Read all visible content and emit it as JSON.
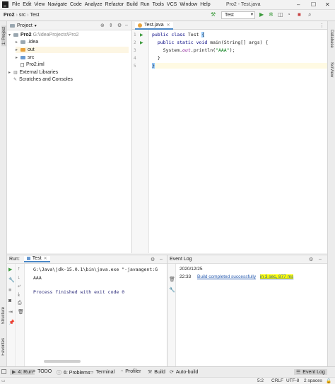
{
  "menubar": {
    "items": [
      "File",
      "Edit",
      "View",
      "Navigate",
      "Code",
      "Analyze",
      "Refactor",
      "Build",
      "Run",
      "Tools",
      "VCS",
      "Window",
      "Help"
    ],
    "window_title": "Pro2 - Test.java",
    "minimize": "–",
    "maximize": "☐",
    "close": "✕"
  },
  "navbar": {
    "breadcrumbs": [
      "Pro2",
      "src",
      "Test"
    ],
    "run_config": "Test"
  },
  "left_strip": {
    "top_tab": "1: Project",
    "bottom_tabs": [
      "Structure",
      "Favorites"
    ]
  },
  "right_strip": {
    "tabs": [
      "Database",
      "SciView"
    ]
  },
  "project": {
    "header": "Project",
    "tree": [
      {
        "label": "Pro2",
        "sub": "G:\\IdeaProjects\\Pro2",
        "arrow": "▾",
        "icon": "gray"
      },
      {
        "label": ".idea",
        "arrow": "▸",
        "icon": "gray"
      },
      {
        "label": "out",
        "arrow": "▸",
        "icon": "orange"
      },
      {
        "label": "src",
        "arrow": "▸",
        "icon": "blue"
      },
      {
        "label": "Pro2.iml",
        "arrow": "",
        "icon": "file"
      },
      {
        "label": "External Libraries",
        "arrow": "▸",
        "icon": "lib"
      },
      {
        "label": "Scratches and Consoles",
        "arrow": "",
        "icon": "scratch"
      }
    ]
  },
  "editor": {
    "tab": "Test.java",
    "line_numbers": [
      "1",
      "2",
      "3",
      "4",
      "5"
    ],
    "lines": [
      {
        "a": "public class ",
        "b": "Test ",
        "c": "{"
      },
      {
        "a": "  public static void ",
        "b": "main(String[] args) {",
        "c": ""
      },
      {
        "a": "    System.",
        "b": "out",
        "c": ".println(",
        "d": "\"AAA\"",
        "e": ");"
      },
      {
        "a": "  }",
        "b": "",
        "c": ""
      },
      {
        "a": "}",
        "b": "",
        "c": ""
      }
    ]
  },
  "run": {
    "label": "Run:",
    "tab": "Test",
    "console": [
      "G:\\Java\\jdk-15.0.1\\bin\\java.exe \"-javaagent:G",
      "AAA",
      "",
      "Process finished with exit code 0"
    ]
  },
  "eventlog": {
    "title": "Event Log",
    "date": "2020/12/25",
    "time": "22:33",
    "message": "Build completed successfully",
    "duration": "in 3 sec, 877 ms"
  },
  "bottombar": {
    "items": [
      "4: Run",
      "TODO",
      "6: Problems",
      "Terminal",
      "Profiler",
      "Build",
      "Auto-build"
    ],
    "event_log": "Event Log"
  },
  "statusbar": {
    "position": "5:2",
    "line_sep": "CRLF",
    "encoding": "UTF-8",
    "indent": "2 spaces"
  }
}
